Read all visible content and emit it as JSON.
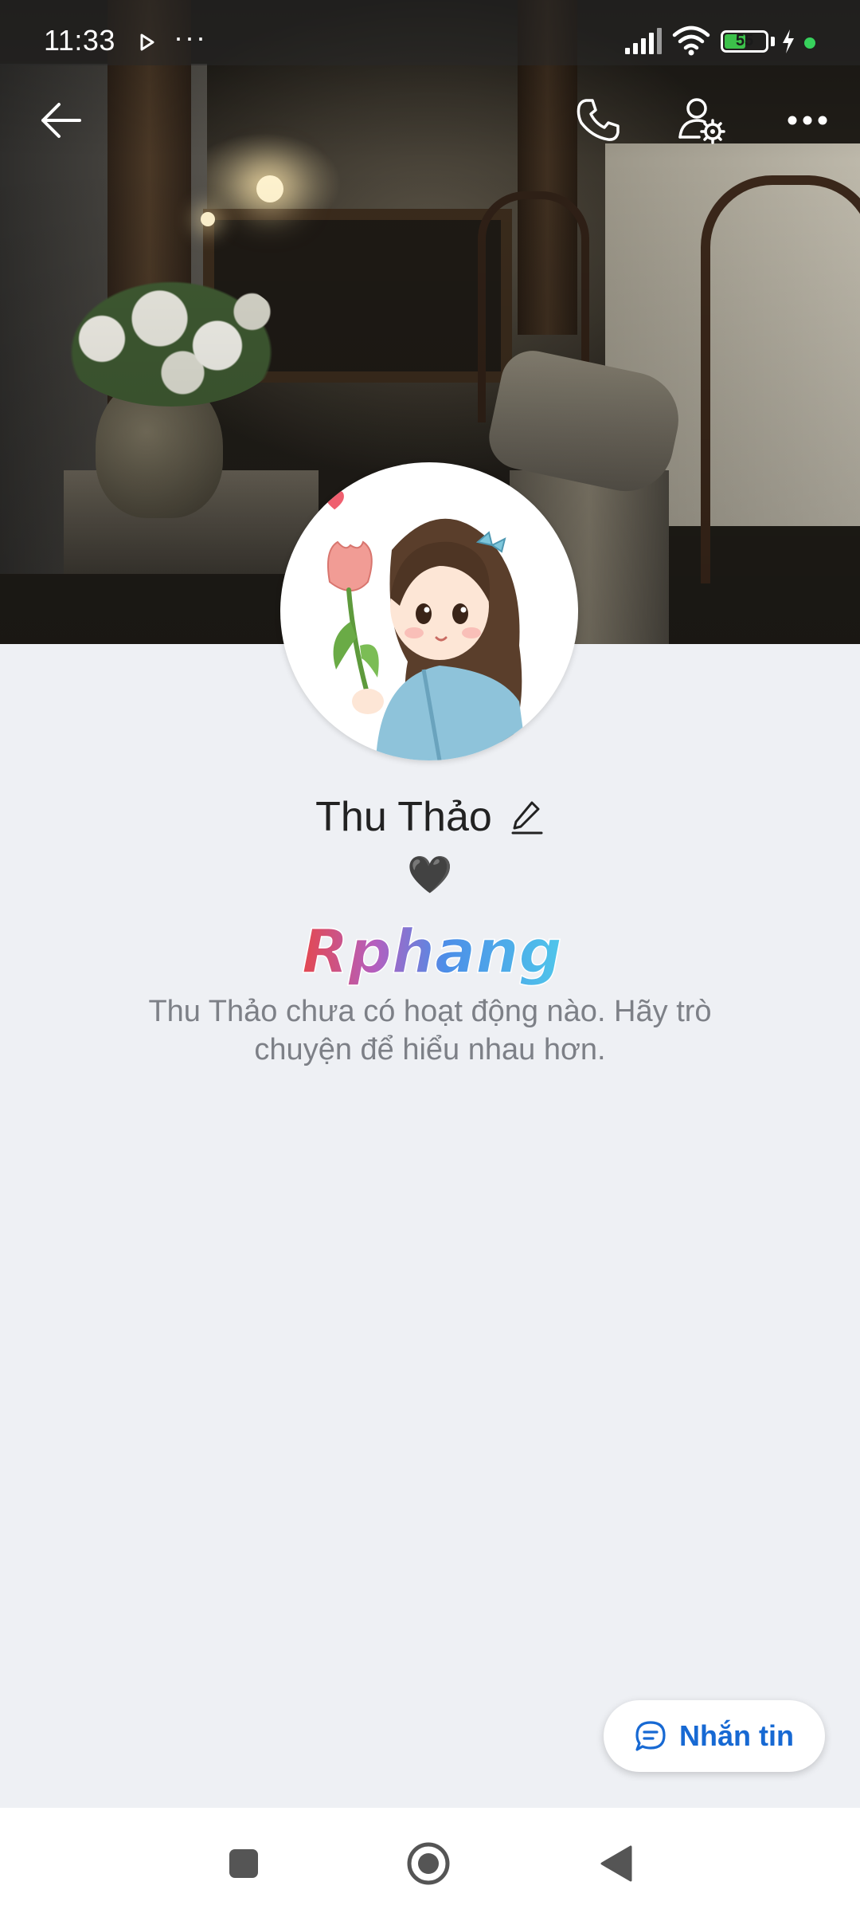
{
  "status_bar": {
    "time": "11:33",
    "more": "···",
    "battery": "55",
    "battery_level_percent": 55
  },
  "top_nav": {
    "back_icon": "arrow-left-icon",
    "call_icon": "phone-icon",
    "settings_icon": "user-settings-icon",
    "more_icon": "more-horizontal-icon"
  },
  "profile": {
    "name": "Thu Thảo",
    "edit_icon": "pencil-icon",
    "status_emoji": "🖤",
    "watermark": "Rphang",
    "empty_message": "Thu Thảo chưa có hoạt động nào. Hãy trò chuyện để hiểu nhau hơn."
  },
  "actions": {
    "message_label": "Nhắn tin",
    "message_icon": "chat-bubble-icon"
  },
  "nav_bar": {
    "recents_icon": "square-icon",
    "home_icon": "circle-home-icon",
    "back_icon": "triangle-back-icon"
  },
  "colors": {
    "accent": "#1769d3",
    "background": "#eef0f4",
    "battery": "#3cc14a"
  }
}
